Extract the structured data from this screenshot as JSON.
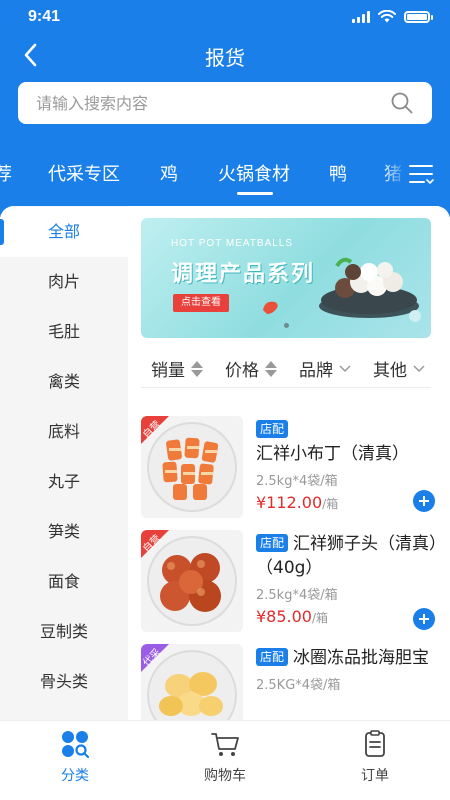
{
  "status_bar": {
    "time": "9:41"
  },
  "nav": {
    "title": "报货"
  },
  "search": {
    "placeholder": "请输入搜索内容"
  },
  "categories": [
    {
      "label": "荐"
    },
    {
      "label": "代采专区"
    },
    {
      "label": "鸡"
    },
    {
      "label": "火锅食材",
      "active": true
    },
    {
      "label": "鸭"
    },
    {
      "label": "猪"
    }
  ],
  "sidebar": {
    "items": [
      {
        "label": "全部",
        "active": true
      },
      {
        "label": "肉片"
      },
      {
        "label": "毛肚"
      },
      {
        "label": "禽类"
      },
      {
        "label": "底料"
      },
      {
        "label": "丸子"
      },
      {
        "label": "笋类"
      },
      {
        "label": "面食"
      },
      {
        "label": "豆制类"
      },
      {
        "label": "骨头类"
      }
    ]
  },
  "banner": {
    "subtitle_en": "HOT POT MEATBALLS",
    "title": "调理产品系列",
    "button": "点击查看"
  },
  "sort": {
    "sales": "销量",
    "price": "价格",
    "brand": "品牌",
    "other": "其他"
  },
  "products": [
    {
      "badge": "自营",
      "tag": "店配",
      "name": "汇祥小布丁（清真）",
      "spec": "2.5kg*4袋/箱",
      "price": "¥112.00",
      "unit": "/箱"
    },
    {
      "badge": "自营",
      "tag": "店配",
      "name": "汇祥狮子头（清真）（40g）",
      "spec": "2.5kg*4袋/箱",
      "price": "¥85.00",
      "unit": "/箱"
    },
    {
      "badge": "代采",
      "tag": "店配",
      "name": "冰圈冻品批海胆宝",
      "spec": "2.5KG*4袋/箱",
      "price": "",
      "unit": ""
    }
  ],
  "tabbar": {
    "category": "分类",
    "cart": "购物车",
    "orders": "订单"
  },
  "colors": {
    "primary": "#1a7fe8",
    "price": "#e12c2c",
    "badge_self": "#e8403a",
    "badge_proxy": "#9b5de5"
  }
}
